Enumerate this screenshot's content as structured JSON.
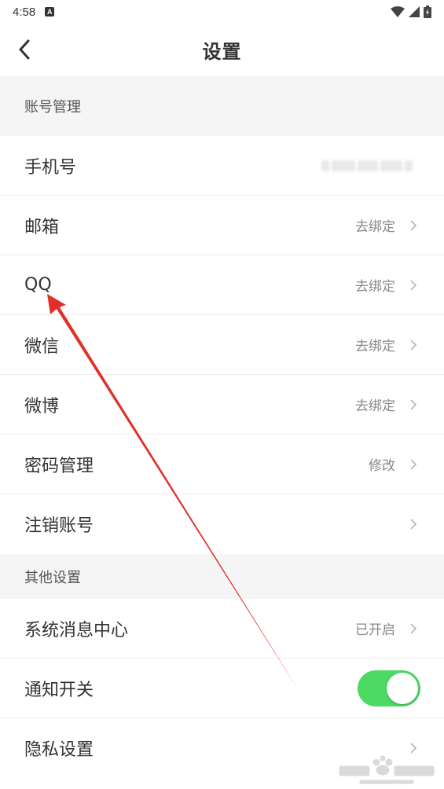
{
  "status_bar": {
    "time": "4:58",
    "app_icon_letter": "A"
  },
  "nav": {
    "title": "设置"
  },
  "sections": [
    {
      "header": "账号管理",
      "rows": [
        {
          "label": "手机号",
          "value": ""
        },
        {
          "label": "邮箱",
          "value": "去绑定"
        },
        {
          "label": "QQ",
          "value": "去绑定"
        },
        {
          "label": "微信",
          "value": "去绑定"
        },
        {
          "label": "微博",
          "value": "去绑定"
        },
        {
          "label": "密码管理",
          "value": "修改"
        },
        {
          "label": "注销账号",
          "value": ""
        }
      ]
    },
    {
      "header": "其他设置",
      "rows": [
        {
          "label": "系统消息中心",
          "value": "已开启"
        },
        {
          "label": "通知开关",
          "toggle_on": true
        },
        {
          "label": "隐私设置",
          "value": ""
        }
      ]
    }
  ],
  "colors": {
    "toggle_on": "#4cd964",
    "arrow": "#e0302a",
    "section_bg": "#f5f5f5"
  },
  "icons": [
    "back-arrow-icon",
    "chevron-right-icon",
    "wifi-icon",
    "signal-icon",
    "battery-icon"
  ]
}
